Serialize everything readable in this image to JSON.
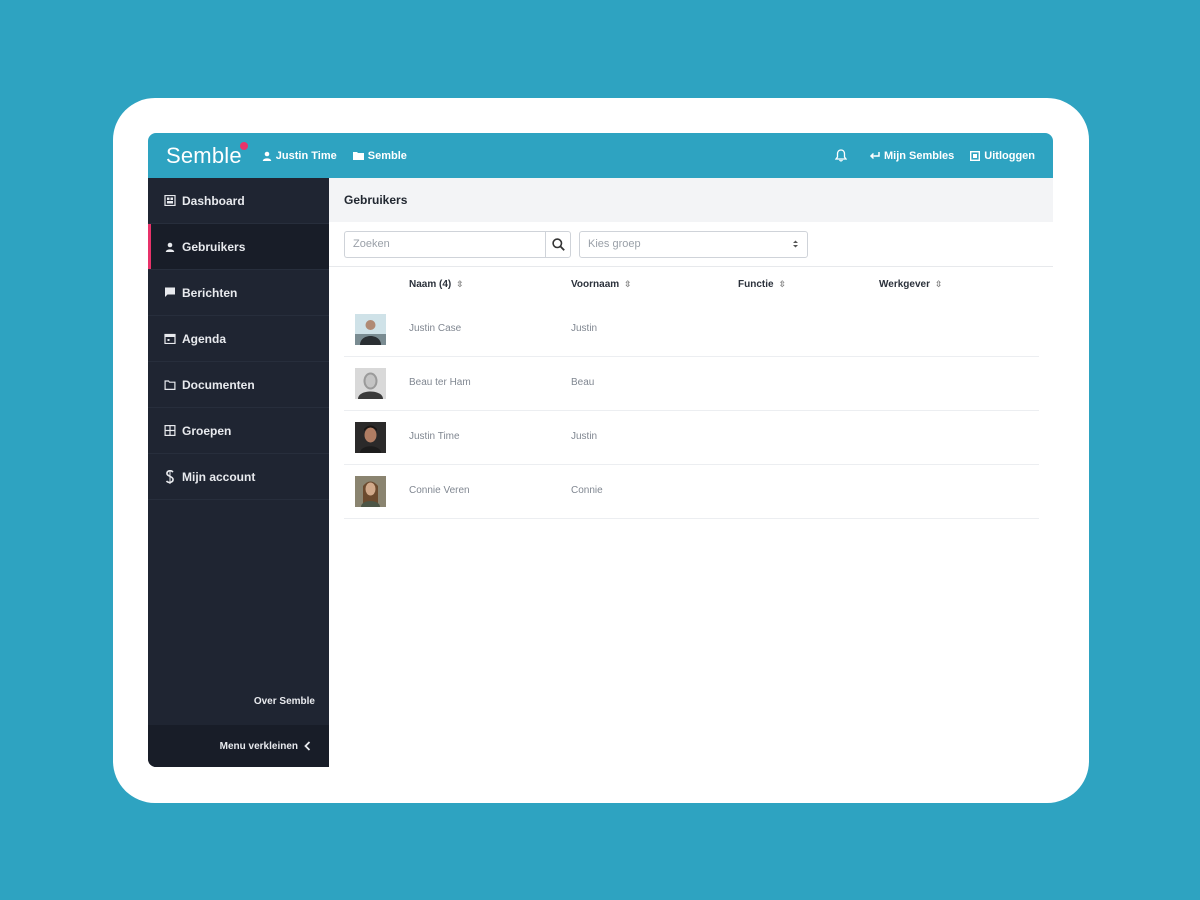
{
  "app": {
    "logo": "Semble",
    "brand_accent": "#e8336a",
    "topbar_color": "#2ea3c1",
    "sidebar_color": "#1f2532"
  },
  "topbar": {
    "user_label": "Justin Time",
    "user_icon": "user-icon",
    "org_label": "Semble",
    "org_icon": "folder-icon",
    "bell_icon": "bell-icon",
    "my_sembles_label": "Mijn Sembles",
    "my_sembles_icon": "return-arrow-icon",
    "logout_label": "Uitloggen",
    "logout_icon": "logout-icon"
  },
  "sidebar": {
    "items": [
      {
        "label": "Dashboard",
        "icon": "dashboard-icon",
        "active": false
      },
      {
        "label": "Gebruikers",
        "icon": "user-icon",
        "active": true
      },
      {
        "label": "Berichten",
        "icon": "message-icon",
        "active": false
      },
      {
        "label": "Agenda",
        "icon": "calendar-icon",
        "active": false
      },
      {
        "label": "Documenten",
        "icon": "folder-icon",
        "active": false
      },
      {
        "label": "Groepen",
        "icon": "groups-icon",
        "active": false
      },
      {
        "label": "Mijn account",
        "icon": "account-icon",
        "active": false
      }
    ],
    "about_label": "Over Semble",
    "collapse_label": "Menu verkleinen",
    "collapse_icon": "chevron-left-icon"
  },
  "main": {
    "title": "Gebruikers",
    "search": {
      "placeholder": "Zoeken",
      "value": ""
    },
    "group_select": {
      "placeholder": "Kies groep"
    },
    "table": {
      "columns": [
        "Naam (4)",
        "Voornaam",
        "Functie",
        "Werkgever"
      ],
      "rows": [
        {
          "naam": "Justin Case",
          "voornaam": "Justin",
          "functie": "",
          "werkgever": ""
        },
        {
          "naam": "Beau ter Ham",
          "voornaam": "Beau",
          "functie": "",
          "werkgever": ""
        },
        {
          "naam": "Justin Time",
          "voornaam": "Justin",
          "functie": "",
          "werkgever": ""
        },
        {
          "naam": "Connie Veren",
          "voornaam": "Connie",
          "functie": "",
          "werkgever": ""
        }
      ]
    }
  }
}
